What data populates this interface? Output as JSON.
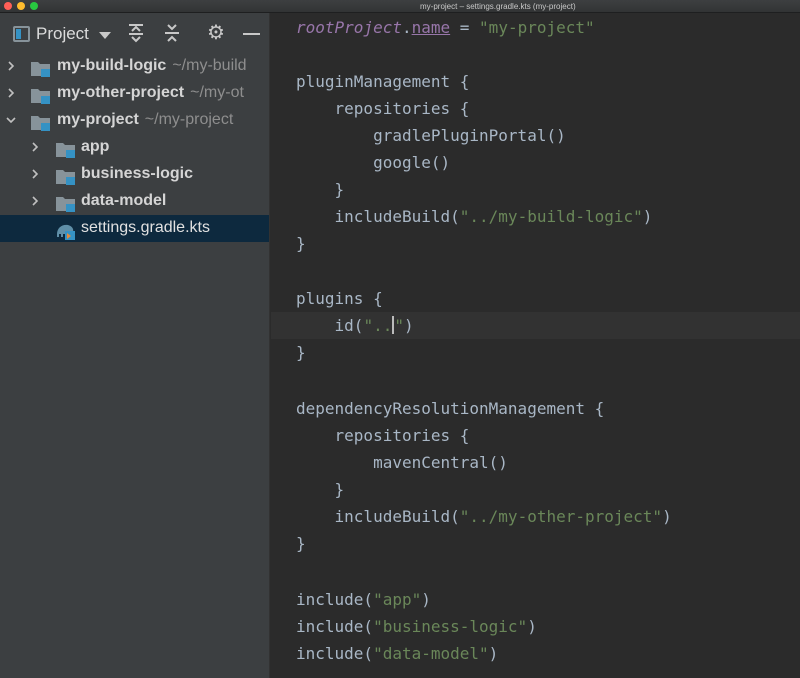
{
  "window": {
    "title": "my-project – settings.gradle.kts (my-project)"
  },
  "sidebar": {
    "view_label": "Project",
    "tree": [
      {
        "name": "my-build-logic",
        "path": "~/my-build",
        "expanded": false
      },
      {
        "name": "my-other-project",
        "path": "~/my-ot",
        "expanded": false
      },
      {
        "name": "my-project",
        "path": "~/my-project",
        "expanded": true
      },
      {
        "name": "app",
        "expanded": false
      },
      {
        "name": "business-logic",
        "expanded": false
      },
      {
        "name": "data-model",
        "expanded": false
      },
      {
        "name": "settings.gradle.kts",
        "selected": true
      }
    ]
  },
  "editor": {
    "lines": [
      [
        "rootProject",
        ".",
        "name",
        " = ",
        "\"my-project\""
      ],
      [],
      [
        "pluginManagement {"
      ],
      [
        "    repositories {"
      ],
      [
        "        gradlePluginPortal()"
      ],
      [
        "        google()"
      ],
      [
        "    }"
      ],
      [
        "    includeBuild(",
        "\"../my-build-logic\"",
        ")"
      ],
      [
        "}"
      ],
      [],
      [
        "plugins {"
      ],
      [
        "    id(",
        "\"..",
        "\"",
        ")"
      ],
      [
        "}"
      ],
      [],
      [
        "dependencyResolutionManagement {"
      ],
      [
        "    repositories {"
      ],
      [
        "        mavenCentral()"
      ],
      [
        "    }"
      ],
      [
        "    includeBuild(",
        "\"../my-other-project\"",
        ")"
      ],
      [
        "}"
      ],
      [],
      [
        "include(",
        "\"app\"",
        ")"
      ],
      [
        "include(",
        "\"business-logic\"",
        ")"
      ],
      [
        "include(",
        "\"data-model\"",
        ")"
      ]
    ]
  },
  "colors": {
    "sidebar_bg": "#3c3f41",
    "editor_bg": "#2b2b2b",
    "selection_bg": "#0d293e",
    "keyword": "#9876aa",
    "string": "#6a8759",
    "text": "#a9b7c6"
  }
}
